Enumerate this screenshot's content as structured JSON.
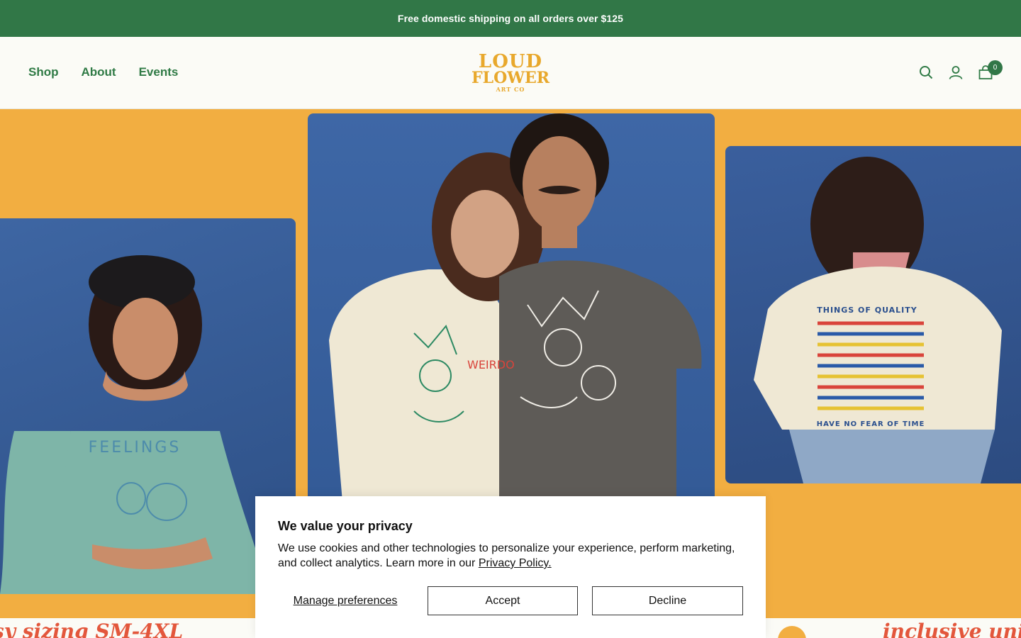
{
  "announcement": "Free domestic shipping on all orders over $125",
  "nav": {
    "items": [
      "Shop",
      "About",
      "Events"
    ]
  },
  "logo": {
    "line1": "LOUD",
    "line2": "FLOWER",
    "line3": "ART CO"
  },
  "header_icons": {
    "search": "search-icon",
    "account": "user-icon",
    "cart": "cart-icon",
    "cart_count": "0"
  },
  "hero": {
    "left_shirt_text": "FEELINGS",
    "center_shirt_text": "WEIRDO",
    "right_shirt_top": "THINGS OF QUALITY",
    "right_shirt_bottom": "HAVE NO FEAR OF TIME"
  },
  "ticker": {
    "text1": "sy sizing SM-4XL",
    "text2": "inclusive unis"
  },
  "cookie": {
    "title": "We value your privacy",
    "body": "We use cookies and other technologies to personalize your experience, perform marketing, and collect analytics. Learn more in our ",
    "link": "Privacy Policy.",
    "manage": "Manage preferences",
    "accept": "Accept",
    "decline": "Decline"
  },
  "colors": {
    "brand_green": "#317747",
    "hero_orange": "#f2ae41",
    "logo_gold": "#e8a82c",
    "backdrop_blue": "#3e66a3"
  }
}
